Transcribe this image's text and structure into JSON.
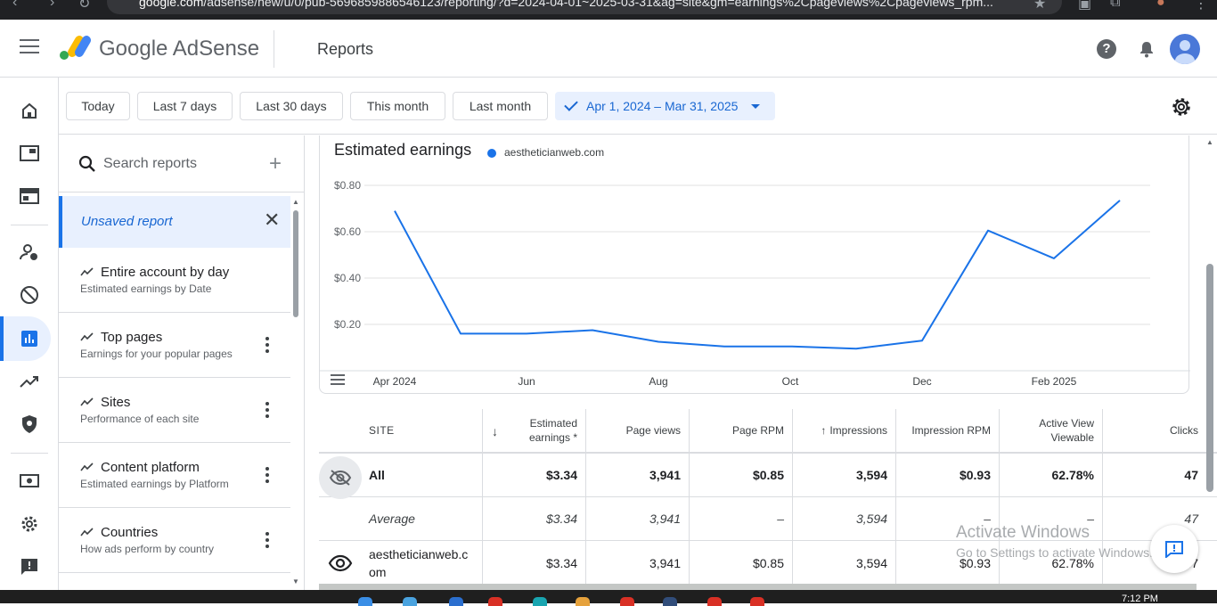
{
  "browser": {
    "url_host": "google.com",
    "url_path": "/adsense/new/u/0/pub-5696859886546123/reporting/?d=2024-04-01~2025-03-31&ag=site&gm=earnings%2Cpageviews%2Cpageviews_rpm..."
  },
  "header": {
    "brand": "Google AdSense",
    "page_title": "Reports",
    "help_label": "?"
  },
  "filters": {
    "chips": [
      "Today",
      "Last 7 days",
      "Last 30 days",
      "This month",
      "Last month"
    ],
    "selected_range": "Apr 1, 2024 – Mar 31, 2025"
  },
  "reports_panel": {
    "search_placeholder": "Search reports",
    "unsaved_label": "Unsaved report",
    "items": [
      {
        "title": "Entire account by day",
        "subtitle": "Estimated earnings by Date"
      },
      {
        "title": "Top pages",
        "subtitle": "Earnings for your popular pages"
      },
      {
        "title": "Sites",
        "subtitle": "Performance of each site"
      },
      {
        "title": "Content platform",
        "subtitle": "Estimated earnings by Platform"
      },
      {
        "title": "Countries",
        "subtitle": "How ads perform by country"
      }
    ]
  },
  "chart_data": {
    "type": "line",
    "title": "Estimated earnings",
    "series": [
      {
        "name": "aestheticianweb.com",
        "color": "#1a73e8",
        "values": [
          0.69,
          0.16,
          0.16,
          0.175,
          0.125,
          0.105,
          0.105,
          0.095,
          0.13,
          0.605,
          0.485,
          0.735
        ]
      }
    ],
    "x": [
      "Apr 2024",
      "May 2024",
      "Jun 2024",
      "Jul 2024",
      "Aug 2024",
      "Sep 2024",
      "Oct 2024",
      "Nov 2024",
      "Dec 2024",
      "Jan 2025",
      "Feb 2025",
      "Mar 2025"
    ],
    "x_tick_labels": [
      "Apr 2024",
      "Jun",
      "Aug",
      "Oct",
      "Dec",
      "Feb 2025"
    ],
    "x_tick_indices": [
      0,
      2,
      4,
      6,
      8,
      10
    ],
    "y_ticks": [
      "$0.20",
      "$0.40",
      "$0.60",
      "$0.80"
    ],
    "y_tick_values": [
      0.2,
      0.4,
      0.6,
      0.8
    ],
    "ylim": [
      0,
      0.8
    ],
    "grid": true,
    "legend": "top-left"
  },
  "table": {
    "headers": {
      "site": "SITE",
      "earnings": "Estimated earnings *",
      "pageviews": "Page views",
      "page_rpm": "Page RPM",
      "impressions": "Impressions",
      "impression_rpm": "Impression RPM",
      "active_view": "Active View Viewable",
      "clicks": "Clicks"
    },
    "total": {
      "site": "All",
      "earnings": "$3.34",
      "pageviews": "3,941",
      "page_rpm": "$0.85",
      "impressions": "3,594",
      "impression_rpm": "$0.93",
      "active_view": "62.78%",
      "clicks": "47"
    },
    "average": {
      "site": "Average",
      "earnings": "$3.34",
      "pageviews": "3,941",
      "page_rpm": "–",
      "impressions": "3,594",
      "impression_rpm": "–",
      "active_view": "–",
      "clicks": "47"
    },
    "rows": [
      {
        "site": "aestheticianweb.com",
        "earnings": "$3.34",
        "pageviews": "3,941",
        "page_rpm": "$0.85",
        "impressions": "3,594",
        "impression_rpm": "$0.93",
        "active_view": "62.78%",
        "clicks": "47"
      }
    ]
  },
  "watermark": {
    "line1": "Activate Windows",
    "line2": "Go to Settings to activate Windows."
  },
  "taskbar": {
    "time": "7:12 PM"
  },
  "colors": {
    "accent": "#1a73e8",
    "chip_selected_bg": "#e8f0fe"
  }
}
